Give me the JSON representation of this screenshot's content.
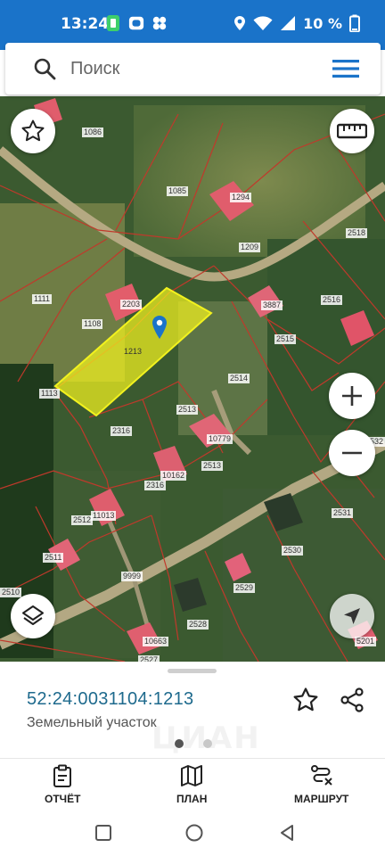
{
  "status_bar": {
    "time": "13:24",
    "battery": "10 %",
    "icons": [
      "map-pin-icon",
      "wifi-icon",
      "signal-icon",
      "battery-icon"
    ]
  },
  "search": {
    "placeholder": "Поиск"
  },
  "map": {
    "parcel_labels": [
      "1086",
      "1085",
      "1294",
      "1209",
      "2518",
      "1111",
      "2203",
      "1108",
      "1213",
      "3887",
      "2516",
      "2515",
      "1113",
      "2514",
      "2513",
      "2316",
      "10779",
      "2513",
      "10162",
      "2316",
      "2532",
      "2512",
      "11013",
      "2531",
      "2511",
      "2530",
      "9999",
      "2510",
      "2529",
      "2528",
      "10663",
      "2527",
      "5201"
    ],
    "selected_parcel": "1213",
    "selected_color": "#f2f21e"
  },
  "sheet": {
    "cadastral_number": "52:24:0031104:1213",
    "parcel_type": "Земельный участок",
    "pages": 2,
    "active_page": 0,
    "watermark": "ЦИАН"
  },
  "bottom_nav": {
    "report": "ОТЧЁТ",
    "plan": "ПЛАН",
    "route": "МАРШРУТ"
  },
  "colors": {
    "status_bar": "#1a73c9",
    "accent": "#1e6a8d",
    "parcel_border": "#c0392b"
  }
}
